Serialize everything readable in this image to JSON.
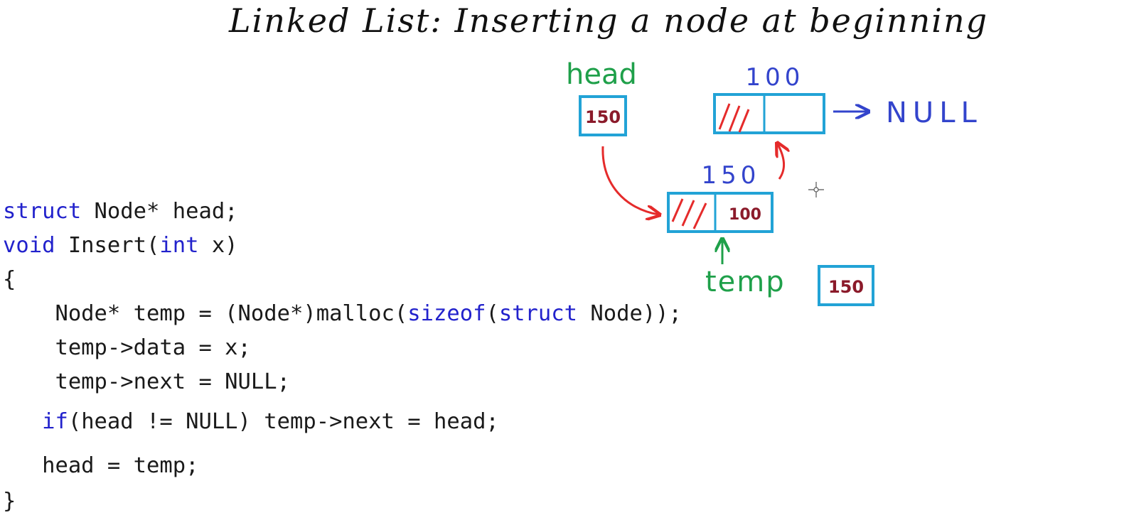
{
  "title": "Linked List: Inserting a node at beginning",
  "code": {
    "line1": {
      "kw": "struct",
      "rest": " Node* head;"
    },
    "line2": {
      "kw": "void",
      "mid": " Insert(",
      "kw2": "int",
      "rest": " x)"
    },
    "line3": {
      "text": "{"
    },
    "line4": {
      "pre": "    Node* temp = (Node*)malloc(",
      "kw": "sizeof",
      "mid": "(",
      "kw2": "struct",
      "rest": " Node));"
    },
    "line5": {
      "text": "    temp->data = x;"
    },
    "line6": {
      "text": "    temp->next = NULL;"
    },
    "line7": {
      "pre": "   ",
      "kw": "if",
      "rest": "(head != NULL) temp->next = head;"
    },
    "line8": {
      "text": "   head = temp;"
    },
    "line9": {
      "text": "}"
    }
  },
  "diagram": {
    "head_label": "head",
    "head_value": "150",
    "node_100_address": "100",
    "node_150_address": "150",
    "node_150_next": "100",
    "null_label": "NULL",
    "temp_label": "temp",
    "temp_value": "150"
  },
  "colors": {
    "box": "#22a3d6",
    "value": "#8b1a2a",
    "address": "#3344cc",
    "label_green": "#1fa04a",
    "arrow_red": "#e52b2b",
    "keyword": "#2222cc"
  }
}
